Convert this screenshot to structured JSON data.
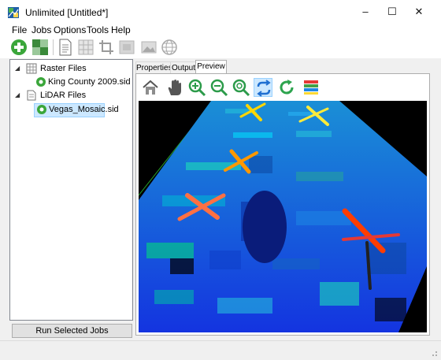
{
  "window": {
    "title": "Unlimited [Untitled*]",
    "controls": {
      "minimize": "–",
      "maximize": "☐",
      "close": "✕"
    }
  },
  "menu": [
    "File",
    "Jobs",
    "Options",
    "Tools",
    "Help"
  ],
  "toolbar": {
    "buttons": [
      "add-icon",
      "raster-grid-icon",
      "document-icon",
      "table-icon",
      "crop-icon",
      "layers-icon",
      "image-icon",
      "globe-icon"
    ]
  },
  "tree": {
    "raster_group": "Raster Files",
    "raster_items": [
      "King County 2009.sid"
    ],
    "lidar_group": "LiDAR Files",
    "lidar_items": [
      "Vegas_Mosaic.sid"
    ]
  },
  "run_button": "Run Selected Jobs",
  "tabs": [
    "Properties",
    "Output",
    "Preview"
  ],
  "active_tab": "Preview",
  "viewer_tools": [
    "home-icon",
    "hand-pan-icon",
    "zoom-in-icon",
    "zoom-out-icon",
    "zoom-extent-icon",
    "swap-icon",
    "refresh-icon",
    "color-ramp-icon"
  ],
  "colors": {
    "accent_selection": "#cce8ff",
    "add_green": "#3aa63a",
    "refresh_green": "#2da44e",
    "viewer_background": "#000000",
    "lidar_ground": "#1a3cff",
    "lidar_high": "#ff3a1a"
  }
}
